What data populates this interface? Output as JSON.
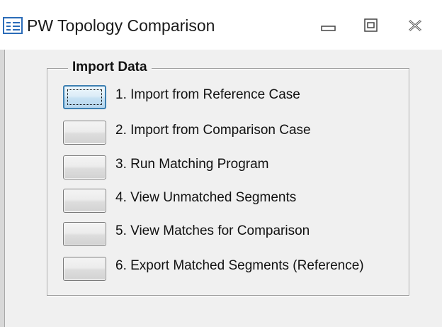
{
  "window": {
    "title": "PW Topology Comparison",
    "icon": "form-icon",
    "controls": {
      "minimize": "minimize-icon",
      "restore": "restore-icon",
      "close": "close-icon"
    }
  },
  "group": {
    "legend": "Import Data"
  },
  "actions": [
    {
      "label": "1. Import from Reference Case",
      "focused": true
    },
    {
      "label": "2. Import from Comparison Case",
      "focused": false
    },
    {
      "label": "3. Run Matching Program",
      "focused": false
    },
    {
      "label": "4. View Unmatched Segments",
      "focused": false
    },
    {
      "label": "5. View Matches for Comparison",
      "focused": false
    },
    {
      "label": "6. Export Matched Segments (Reference)",
      "focused": false
    }
  ],
  "colors": {
    "client_bg": "#f0f0f0",
    "focus_border": "#3c7fb1",
    "icon_blue": "#2b6cb8"
  }
}
